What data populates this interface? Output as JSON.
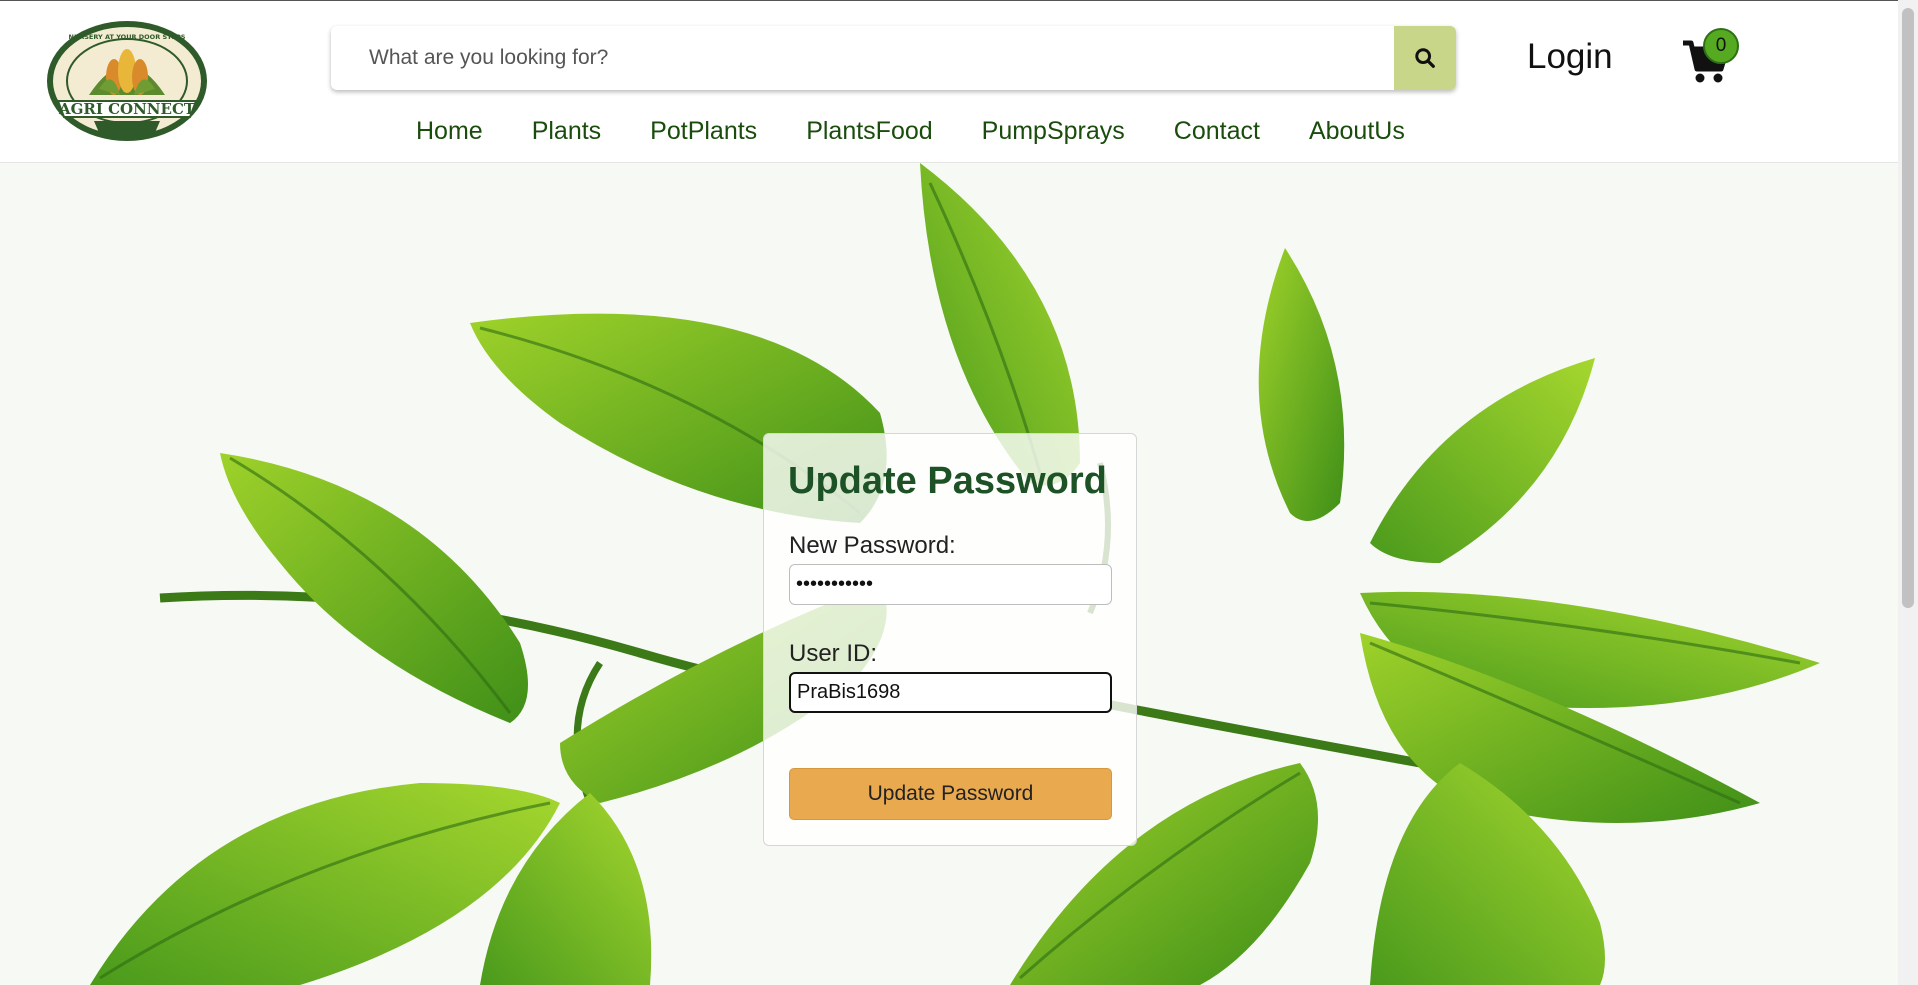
{
  "brand": {
    "logo_text": "AGRI CONNECT",
    "logo_tagline": "NURSERY AT YOUR DOOR STEPS"
  },
  "search": {
    "placeholder": "What are you looking for?",
    "icon": "search-icon"
  },
  "header": {
    "login_label": "Login",
    "cart_count": "0",
    "cart_icon": "cart-icon"
  },
  "nav": {
    "items": [
      {
        "label": "Home"
      },
      {
        "label": "Plants"
      },
      {
        "label": "PotPlants"
      },
      {
        "label": "PlantsFood"
      },
      {
        "label": "PumpSprays"
      },
      {
        "label": "Contact"
      },
      {
        "label": "AboutUs"
      }
    ]
  },
  "form": {
    "title": "Update Password",
    "new_password_label": "New Password:",
    "new_password_value": "•••••••••••",
    "user_id_label": "User ID:",
    "user_id_value": "PraBis1698",
    "submit_label": "Update Password"
  },
  "colors": {
    "brand_green": "#1d5226",
    "nav_green": "#1a4d0d",
    "search_button": "#c8d68a",
    "submit_button": "#e9a94f",
    "badge": "#55aa22"
  }
}
